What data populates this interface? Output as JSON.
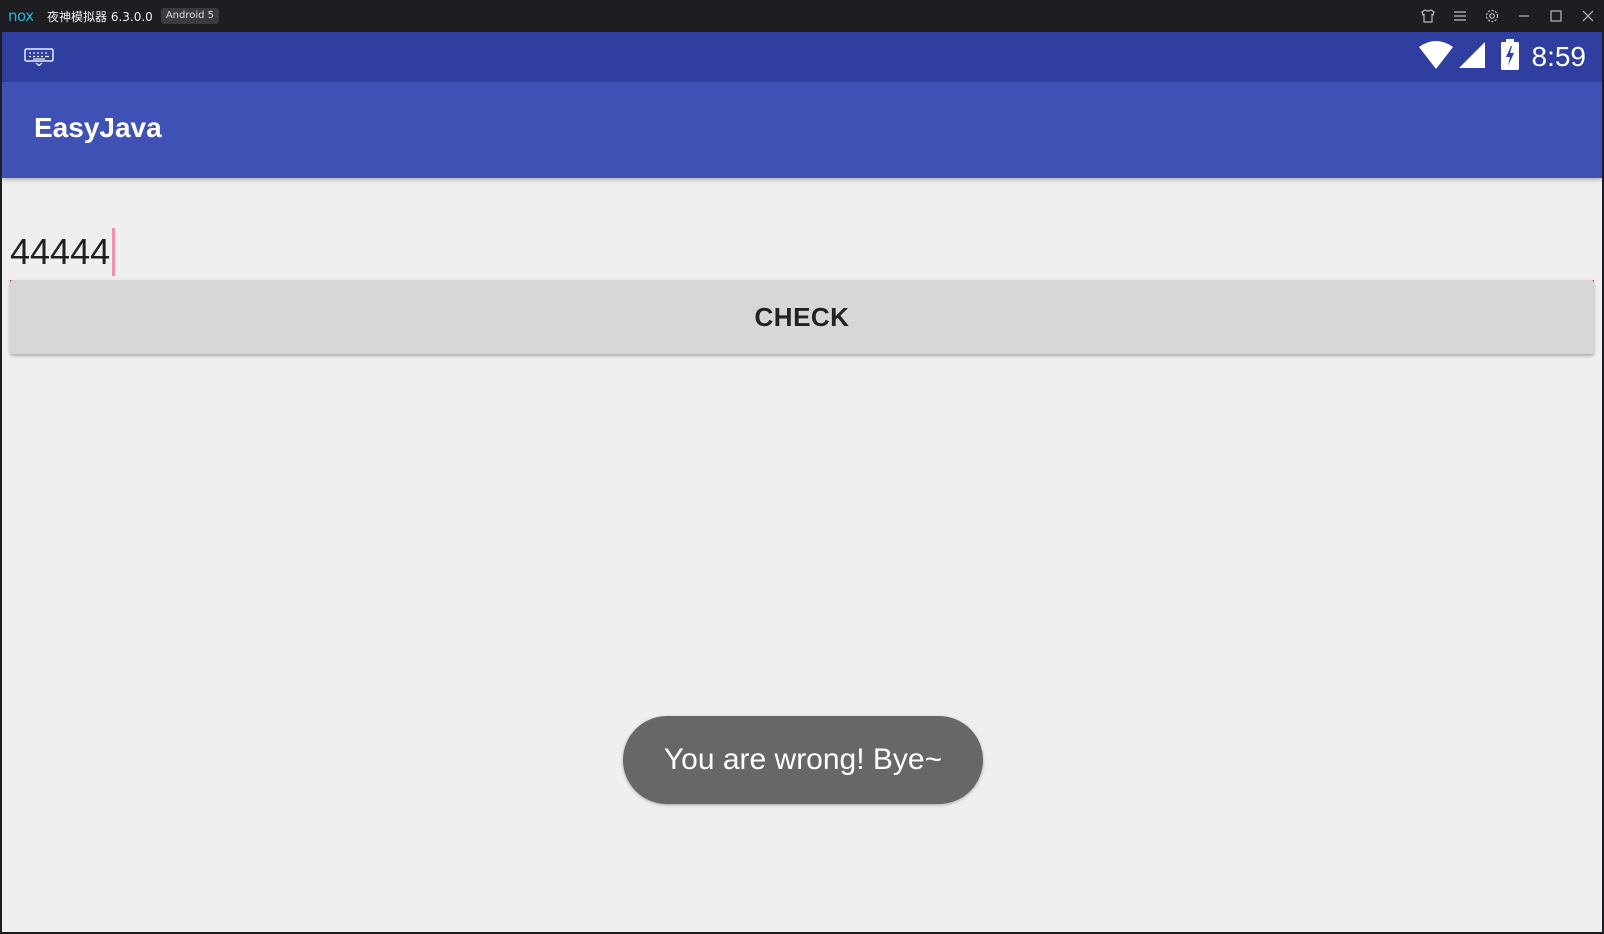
{
  "emulator": {
    "logo_text": "nox",
    "app_name": "夜神模拟器 6.3.0.0",
    "android_badge": "Android 5",
    "controls": [
      "skin-icon",
      "menu-icon",
      "settings-icon",
      "minimize-icon",
      "maximize-icon",
      "close-icon"
    ]
  },
  "statusbar": {
    "left_icon": "keyboard-icon",
    "icons": [
      "wifi-icon",
      "signal-icon",
      "battery-charging-icon"
    ],
    "time": "8:59"
  },
  "app": {
    "title": "EasyJava"
  },
  "input": {
    "value": "44444"
  },
  "check_button": {
    "label": "CHECK"
  },
  "toast": {
    "message": "You are wrong! Bye~"
  },
  "colors": {
    "statusbar": "#303f9f",
    "toolbar": "#3f51b5",
    "accent": "#ec407a",
    "background": "#efefef",
    "button": "#d6d7d7",
    "toast": "#676767"
  }
}
